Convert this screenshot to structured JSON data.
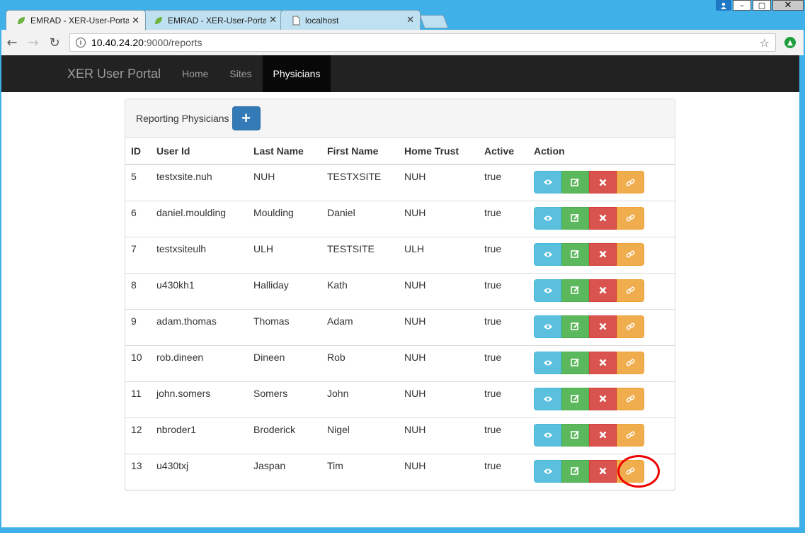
{
  "browser": {
    "tabs": [
      {
        "title": "EMRAD - XER-User-Porta",
        "icon": "spring-leaf-icon",
        "active": true
      },
      {
        "title": "EMRAD - XER-User-Porta",
        "icon": "spring-leaf-icon",
        "active": false
      },
      {
        "title": "localhost",
        "icon": "page-icon",
        "active": false
      }
    ],
    "url_host": "10.40.24.20",
    "url_rest": ":9000/reports"
  },
  "navbar": {
    "brand": "XER User Portal",
    "items": [
      "Home",
      "Sites",
      "Physicians"
    ],
    "active": "Physicians"
  },
  "panel": {
    "title": "Reporting Physicians",
    "add_label": "+"
  },
  "table": {
    "headers": [
      "ID",
      "User Id",
      "Last Name",
      "First Name",
      "Home Trust",
      "Active",
      "Action"
    ],
    "rows": [
      [
        "5",
        "testxsite.nuh",
        "NUH",
        "TESTXSITE",
        "NUH",
        "true"
      ],
      [
        "6",
        "daniel.moulding",
        "Moulding",
        "Daniel",
        "NUH",
        "true"
      ],
      [
        "7",
        "testxsiteulh",
        "ULH",
        "TESTSITE",
        "ULH",
        "true"
      ],
      [
        "8",
        "u430kh1",
        "Halliday",
        "Kath",
        "NUH",
        "true"
      ],
      [
        "9",
        "adam.thomas",
        "Thomas",
        "Adam",
        "NUH",
        "true"
      ],
      [
        "10",
        "rob.dineen",
        "Dineen",
        "Rob",
        "NUH",
        "true"
      ],
      [
        "11",
        "john.somers",
        "Somers",
        "John",
        "NUH",
        "true"
      ],
      [
        "12",
        "nbroder1",
        "Broderick",
        "Nigel",
        "NUH",
        "true"
      ],
      [
        "13",
        "u430txj",
        "Jaspan",
        "Tim",
        "NUH",
        "true"
      ]
    ],
    "action_icons": [
      "eye-icon",
      "edit-icon",
      "delete-icon",
      "link-icon"
    ]
  },
  "colors": {
    "view": "#5bc0de",
    "edit": "#5cb85c",
    "delete": "#d9534f",
    "link": "#f0ad4e",
    "primary": "#337ab7",
    "highlight": "#e00000"
  }
}
